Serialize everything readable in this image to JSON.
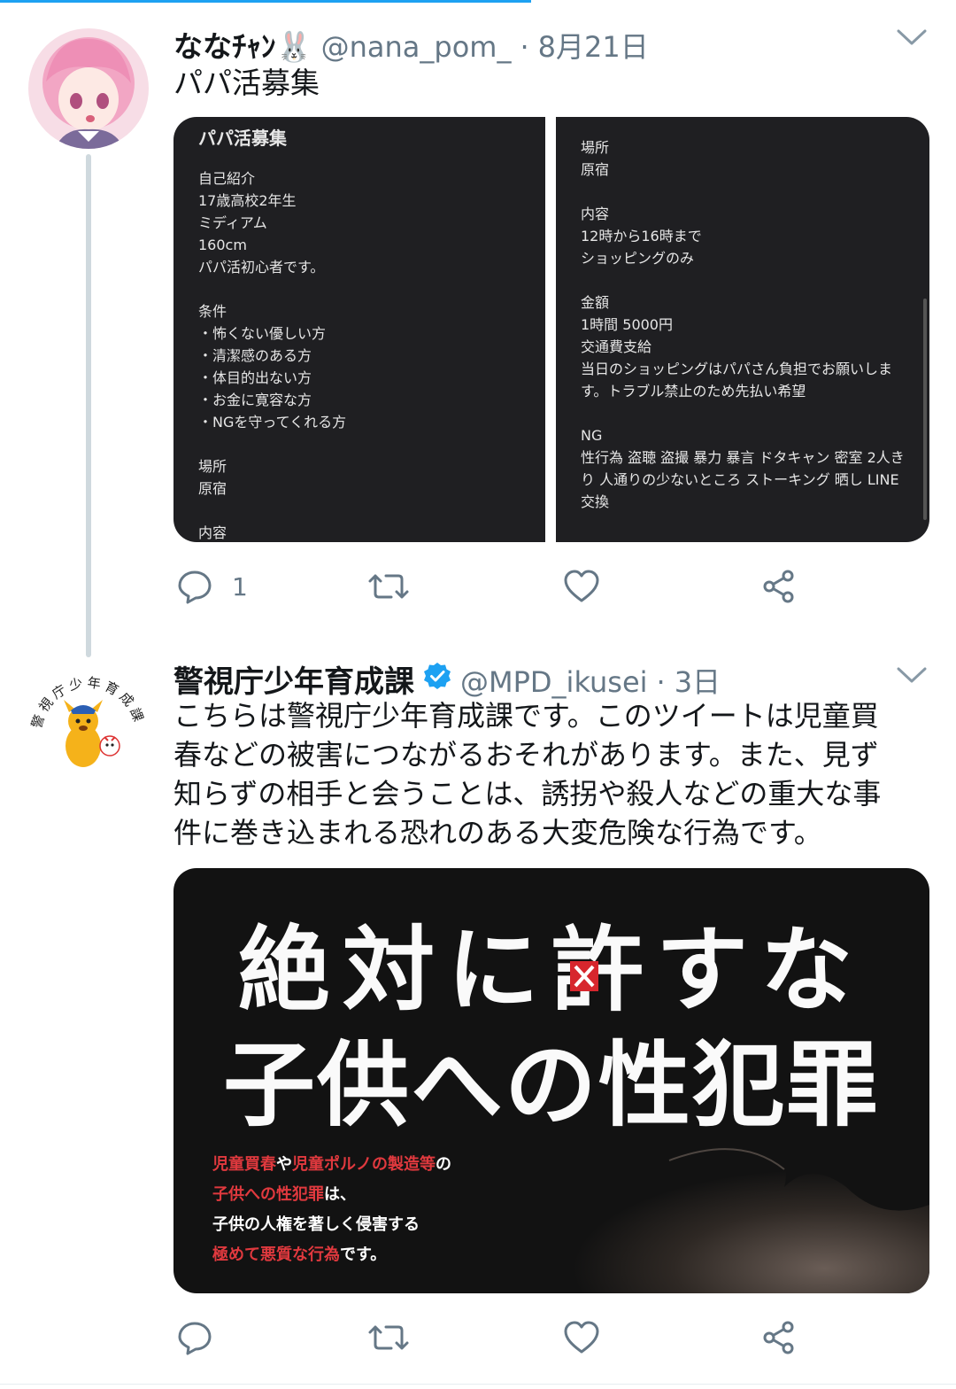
{
  "tweets": [
    {
      "display_name": "ななﾁｬﾝ🐰",
      "handle": "@nana_pom_",
      "separator": "·",
      "time": "8月21日",
      "text": "パパ活募集",
      "media": {
        "left_panel": {
          "title": "パパ活募集",
          "lines": [
            "自己紹介",
            "17歳高校2年生",
            "ミディアム",
            "160cm",
            "パパ活初心者です。",
            "",
            "条件",
            "・怖くない優しい方",
            "・清潔感のある方",
            "・体目的出ない方",
            "・お金に寛容な方",
            "・NGを守ってくれる方",
            "",
            "場所",
            "原宿",
            "",
            "内容"
          ]
        },
        "right_panel": {
          "lines": [
            "場所",
            "原宿",
            "",
            "内容",
            "12時から16時まで",
            "ショッピングのみ",
            "",
            "金額",
            "1時間 5000円",
            "交通費支給",
            "当日のショッピングはパパさん負担でお願いしま",
            "す。トラブル禁止のため先払い希望",
            "",
            "NG",
            "性行為 盗聴 盗撮 暴力 暴言 ドタキャン 密室 2人き",
            "り 人通りの少ないところ ストーキング 晒し LINE",
            "交換"
          ]
        }
      },
      "actions": {
        "reply_count": "1"
      }
    },
    {
      "display_name": "警視庁少年育成課",
      "verified": true,
      "handle": "@MPD_ikusei",
      "separator": "·",
      "time": "3日",
      "avatar_text": "警視庁少年育成課",
      "text_lines": [
        "こちらは警視庁少年育成課です。このツイートは児童買",
        "春などの被害につながるおそれがあります。また、見ず",
        "知らずの相手と会うことは、誘拐や殺人などの重大な事",
        "件に巻き込まれる恐れのある大変危険な行為です。"
      ],
      "poster": {
        "headline_1": "絶対に許すな",
        "headline_2": "子供への性犯罪",
        "body": [
          [
            {
              "t": "児童買春",
              "red": true
            },
            {
              "t": "や",
              "red": false
            },
            {
              "t": "児童ポルノの製造等",
              "red": true
            },
            {
              "t": "の",
              "red": false
            }
          ],
          [
            {
              "t": "子供への性犯罪",
              "red": true
            },
            {
              "t": "は、",
              "red": false
            }
          ],
          [
            {
              "t": "子供の人権を著しく侵害する",
              "red": false
            }
          ],
          [
            {
              "t": "極めて悪質な行為",
              "red": true
            },
            {
              "t": "です。",
              "red": false
            }
          ]
        ]
      }
    }
  ],
  "colors": {
    "link_blue": "#1da1f2",
    "icon_gray": "#657786",
    "thread_line": "#cfd9de",
    "poster_red": "#e0393e"
  },
  "icons": [
    "reply-icon",
    "retweet-icon",
    "like-icon",
    "share-icon",
    "chevron-down-icon",
    "verified-badge-icon"
  ]
}
